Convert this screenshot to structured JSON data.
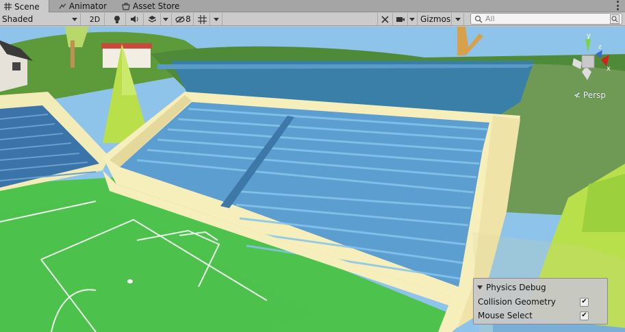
{
  "tabs": [
    {
      "label": "Scene",
      "icon": "scene-hash-icon",
      "active": true
    },
    {
      "label": "Animator",
      "icon": "animator-icon",
      "active": false
    },
    {
      "label": "Asset Store",
      "icon": "asset-store-icon",
      "active": false
    }
  ],
  "toolbar": {
    "shading_mode": "Shaded",
    "mode_2d": "2D",
    "hidden_count": "8",
    "gizmos_label": "Gizmos",
    "search_placeholder": "All"
  },
  "scene": {
    "projection_label": "Persp",
    "gizmo_axes": {
      "y": "y",
      "x": "x",
      "z": "z"
    }
  },
  "physics_debug": {
    "title": "Physics Debug",
    "options": [
      {
        "label": "Collision Geometry",
        "checked": true
      },
      {
        "label": "Mouse Select",
        "checked": true
      }
    ]
  }
}
